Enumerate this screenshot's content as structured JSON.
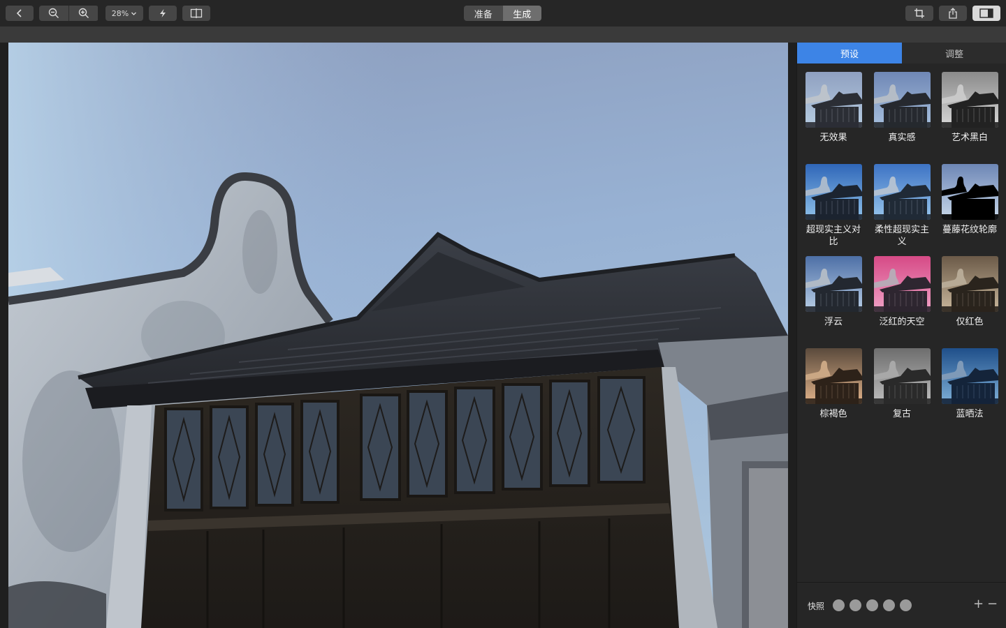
{
  "toolbar": {
    "back_icon": "chevron-left-icon",
    "zoom_out_icon": "zoom-out-icon",
    "zoom_in_icon": "zoom-in-icon",
    "zoom_level": "28%",
    "auto_icon": "lightning-icon",
    "compare_icon": "split-view-icon",
    "mode_prepare": "准备",
    "mode_generate": "生成",
    "crop_icon": "crop-icon",
    "share_icon": "share-icon",
    "sidebar_icon": "sidebar-toggle-icon"
  },
  "sidebar": {
    "tab_presets": "预设",
    "tab_adjust": "调整",
    "presets": [
      {
        "label": "无效果",
        "style": "none"
      },
      {
        "label": "真实感",
        "style": "real"
      },
      {
        "label": "艺术黑白",
        "style": "bw"
      },
      {
        "label": "超现实主义对比",
        "style": "surreal"
      },
      {
        "label": "柔性超现实主义",
        "style": "soft"
      },
      {
        "label": "蔓藤花纹轮廓",
        "style": "silhouette"
      },
      {
        "label": "浮云",
        "style": "cloud"
      },
      {
        "label": "泛红的天空",
        "style": "redsky"
      },
      {
        "label": "仅红色",
        "style": "redonly"
      },
      {
        "label": "棕褐色",
        "style": "sepia"
      },
      {
        "label": "复古",
        "style": "vintage"
      },
      {
        "label": "蓝晒法",
        "style": "cyan"
      }
    ],
    "snapshot_label": "快照",
    "snapshot_add": "+",
    "snapshot_remove": "−"
  },
  "colors": {
    "accent": "#3d84e6",
    "panel": "#262626",
    "canvas": "#1f1f1f"
  }
}
